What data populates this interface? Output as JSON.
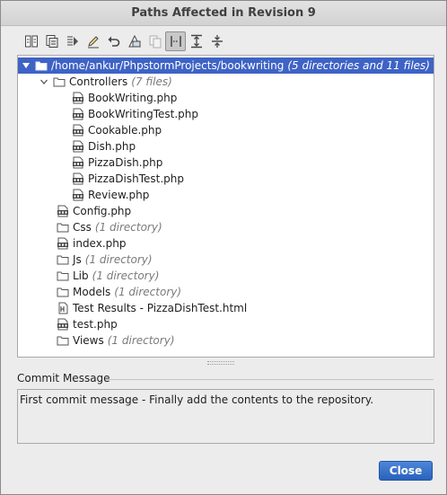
{
  "window": {
    "title": "Paths Affected in Revision 9"
  },
  "toolbar": {
    "buttons": [
      {
        "icon": "show-diff-icon"
      },
      {
        "icon": "show-diff-with-local-icon"
      },
      {
        "icon": "annotate-icon"
      },
      {
        "icon": "edit-source-icon"
      },
      {
        "icon": "revert-icon"
      },
      {
        "icon": "create-patch-icon"
      },
      {
        "icon": "copy-icon"
      },
      {
        "icon": "group-by-directory-icon"
      },
      {
        "icon": "expand-all-icon"
      },
      {
        "icon": "collapse-all-icon"
      }
    ]
  },
  "tree": {
    "root": {
      "path": "/home/ankur/PhpstormProjects/bookwriting",
      "summary": "(5 directories and 11 files)"
    },
    "controllers": {
      "name": "Controllers",
      "summary": "(7 files)",
      "files": [
        "BookWriting.php",
        "BookWritingTest.php",
        "Cookable.php",
        "Dish.php",
        "PizzaDish.php",
        "PizzaDishTest.php",
        "Review.php"
      ]
    },
    "items": [
      {
        "name": "Config.php",
        "summary": "",
        "kind": "php"
      },
      {
        "name": "Css",
        "summary": "(1 directory)",
        "kind": "folder"
      },
      {
        "name": "index.php",
        "summary": "",
        "kind": "php"
      },
      {
        "name": "Js",
        "summary": "(1 directory)",
        "kind": "folder"
      },
      {
        "name": "Lib",
        "summary": "(1 directory)",
        "kind": "folder"
      },
      {
        "name": "Models",
        "summary": "(1 directory)",
        "kind": "folder"
      },
      {
        "name": "Test Results - PizzaDishTest.html",
        "summary": "",
        "kind": "html"
      },
      {
        "name": "test.php",
        "summary": "",
        "kind": "php"
      },
      {
        "name": "Views",
        "summary": "(1 directory)",
        "kind": "folder"
      }
    ]
  },
  "commit": {
    "label": "Commit Message",
    "message": "First commit message - Finally add the contents to the repository."
  },
  "actions": {
    "close_label": "Close"
  },
  "colors": {
    "selection": "#3e63c5",
    "button": "#2a62bc"
  }
}
